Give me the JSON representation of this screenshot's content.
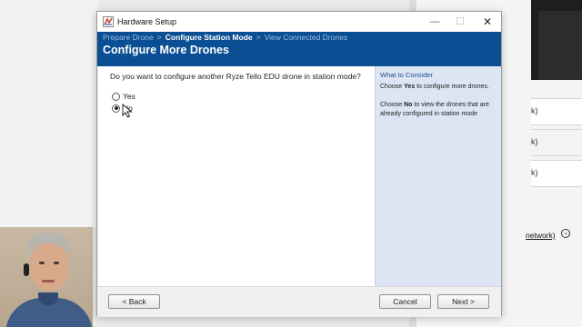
{
  "window": {
    "title": "Hardware Setup"
  },
  "breadcrumb": [
    {
      "label": "Prepare Drone",
      "current": false
    },
    {
      "label": "Configure Station Mode",
      "current": true
    },
    {
      "label": "View Connected Drones",
      "current": false
    }
  ],
  "breadcrumb_separator": ">",
  "page": {
    "heading": "Configure More Drones",
    "question": "Do you want to configure another Ryze Tello EDU drone in station mode?",
    "options": [
      {
        "label": "Yes",
        "selected": false
      },
      {
        "label": "No",
        "selected": true
      }
    ]
  },
  "side_panel": {
    "heading": "What to Consider",
    "tip_yes": {
      "prefix": "Choose ",
      "keyword": "Yes",
      "suffix": " to configure more drones."
    },
    "tip_no": {
      "prefix": "Choose ",
      "keyword": "No",
      "suffix": " to view the drones that are already configured in station mode"
    }
  },
  "footer": {
    "back_label": "< Back",
    "cancel_label": "Cancel",
    "next_label": "Next >"
  },
  "background": {
    "right_rows": [
      "k)",
      "k)",
      "k)"
    ],
    "network_label": "network)"
  },
  "colors": {
    "header_bg": "#0a4e93",
    "side_panel_bg": "#dde4f3",
    "side_heading": "#1f4f8f"
  },
  "icons": [
    "app-icon",
    "minimize-icon",
    "maximize-icon",
    "close-icon",
    "radio-icon",
    "mouse-cursor-icon",
    "chevron-down-icon"
  ]
}
